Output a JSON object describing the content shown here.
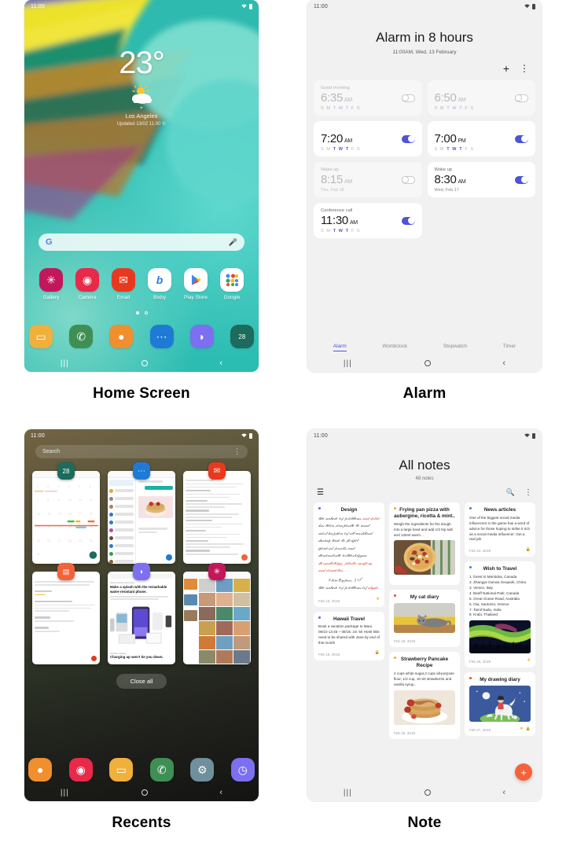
{
  "panels": [
    {
      "caption": "Home Screen"
    },
    {
      "caption": "Alarm"
    },
    {
      "caption": "Recents"
    },
    {
      "caption": "Note"
    }
  ],
  "status_bar": {
    "time": "11:00",
    "wifi_icon": "wifi-icon",
    "battery_icon": "battery-icon"
  },
  "nav_bar": {
    "recents_icon": "recents-icon",
    "home_icon": "home-icon",
    "back_icon": "back-icon"
  },
  "home": {
    "weather": {
      "temperature": "23°",
      "condition_icon": "partly-sunny-icon",
      "location_pin_icon": "location-pin-icon",
      "city": "Los Angeles",
      "updated": "Updated 13/02 11:00",
      "refresh_icon": "refresh-icon"
    },
    "search": {
      "logo": "G",
      "placeholder": "",
      "mic_icon": "microphone-icon"
    },
    "apps": [
      {
        "label": "Gallery",
        "icon": "gallery-icon",
        "glyph": "✳",
        "color": "#c2185b"
      },
      {
        "label": "Camera",
        "icon": "camera-icon",
        "glyph": "◉",
        "color": "#e8294a"
      },
      {
        "label": "Email",
        "icon": "email-icon",
        "glyph": "✉",
        "color": "#e8391f"
      },
      {
        "label": "Bixby",
        "icon": "bixby-icon",
        "glyph": "b",
        "color": "#ffffff"
      },
      {
        "label": "Play Store",
        "icon": "play-store-icon",
        "glyph": "▶",
        "color": "#ffffff"
      },
      {
        "label": "Google",
        "icon": "google-folder-icon",
        "glyph": "⠿",
        "color": "#ffffff"
      }
    ],
    "page_dots": {
      "count": 2,
      "active": 1
    },
    "dock": [
      {
        "icon": "my-files-icon",
        "glyph": "▭",
        "color": "#f0b03c"
      },
      {
        "icon": "phone-icon",
        "glyph": "✆",
        "color": "#3f8f55"
      },
      {
        "icon": "contacts-icon",
        "glyph": "●",
        "color": "#f08f2e"
      },
      {
        "icon": "messages-icon",
        "glyph": "⋯",
        "color": "#1f7ad6"
      },
      {
        "icon": "internet-icon",
        "glyph": "◗",
        "color": "#7c6ff0"
      },
      {
        "icon": "calendar-icon",
        "glyph": "28",
        "color": "#1d6b5c"
      }
    ]
  },
  "alarm": {
    "headline": "Alarm in 8 hours",
    "subhead": "11:00AM, Wed, 13 February",
    "add_icon": "plus-icon",
    "more_icon": "more-options-icon",
    "alarms": [
      {
        "name": "Good morning",
        "time": "6:35",
        "ampm": "AM",
        "days": "SMTWTFS",
        "active_days": [
          2,
          3,
          4
        ],
        "enabled": false,
        "date": ""
      },
      {
        "name": "",
        "time": "6:50",
        "ampm": "AM",
        "days": "SMTWTFS",
        "active_days": [
          2,
          3,
          4
        ],
        "enabled": false,
        "date": ""
      },
      {
        "name": "",
        "time": "7:20",
        "ampm": "AM",
        "days": "SMTWTFS",
        "active_days": [
          2,
          3,
          4
        ],
        "enabled": true,
        "date": ""
      },
      {
        "name": "",
        "time": "7:00",
        "ampm": "PM",
        "days": "SMTWTFS",
        "active_days": [
          2,
          3,
          4
        ],
        "enabled": true,
        "date": ""
      },
      {
        "name": "Wake up",
        "time": "8:15",
        "ampm": "AM",
        "days": "",
        "active_days": [],
        "enabled": false,
        "date": "Thu, Feb 18"
      },
      {
        "name": "Wake up",
        "time": "8:30",
        "ampm": "AM",
        "days": "",
        "active_days": [],
        "enabled": true,
        "date": "Wed, Feb 17"
      },
      {
        "name": "Conference call",
        "time": "11:30",
        "ampm": "AM",
        "days": "SMTWTFS",
        "active_days": [
          2,
          3,
          4
        ],
        "enabled": true,
        "date": ""
      }
    ],
    "tabs": [
      {
        "label": "Alarm",
        "active": true
      },
      {
        "label": "Worldclock",
        "active": false
      },
      {
        "label": "Stopwatch",
        "active": false
      },
      {
        "label": "Timer",
        "active": false
      }
    ],
    "accent": "#4d54d6"
  },
  "recents": {
    "search": {
      "placeholder": "Search",
      "more_icon": "more-options-icon"
    },
    "close_all_label": "Close all",
    "cards": [
      {
        "app": "Calendar",
        "badge_icon": "calendar-icon",
        "badge_glyph": "28",
        "badge_color": "#1d6b5c",
        "type": "calendar"
      },
      {
        "app": "Messages",
        "badge_icon": "messages-icon",
        "badge_glyph": "⋯",
        "badge_color": "#1f7ad6",
        "type": "messages"
      },
      {
        "app": "Email",
        "badge_icon": "email-icon",
        "badge_glyph": "✉",
        "badge_color": "#e8391f",
        "type": "email"
      },
      {
        "app": "Samsung Notes",
        "badge_icon": "notes-icon",
        "badge_glyph": "▤",
        "badge_color": "#f4623a",
        "type": "notes"
      },
      {
        "app": "Internet",
        "badge_icon": "internet-icon",
        "badge_glyph": "◗",
        "badge_color": "#7c6ff0",
        "type": "web",
        "headline": "Make a splash with the remarkable water-resistant phone.",
        "kicker": "Water-resistant technology",
        "footline": "Charging up won't tie you down.",
        "foot_kicker": "Wireless charging"
      },
      {
        "app": "Gallery",
        "badge_icon": "gallery-icon",
        "badge_glyph": "✳",
        "badge_color": "#c2185b",
        "type": "gallery"
      }
    ],
    "dock": [
      {
        "icon": "contacts-icon",
        "glyph": "●",
        "color": "#f08f2e"
      },
      {
        "icon": "camera-icon",
        "glyph": "◉",
        "color": "#e8294a"
      },
      {
        "icon": "my-files-icon",
        "glyph": "▭",
        "color": "#f0b03c"
      },
      {
        "icon": "phone-icon",
        "glyph": "✆",
        "color": "#3f8f55"
      },
      {
        "icon": "settings-icon",
        "glyph": "⚙",
        "color": "#6f8f9c"
      },
      {
        "icon": "clock-icon",
        "glyph": "◷",
        "color": "#7c6ff0"
      }
    ]
  },
  "note": {
    "title": "All notes",
    "count": "48 notes",
    "menu_icon": "hamburger-menu-icon",
    "search_icon": "search-icon",
    "more_icon": "more-options-icon",
    "add_icon": "plus-icon",
    "add_color": "#f4623a",
    "notes": [
      {
        "title": "Design",
        "dot_color": "#4d6ef0",
        "kind": "handwriting",
        "body": "",
        "date": "Feb 13, 2019",
        "starred": true,
        "locked": false,
        "image": ""
      },
      {
        "title": "Hawaii Travel",
        "dot_color": "#4d6ef0",
        "kind": "text",
        "body": "Book a vacation  package to Maui. 08/10 13:45 ~ 08/15 ,19. 50 Hotel lists need to be shared with Jane by end of this month",
        "date": "Feb 15, 2019",
        "starred": false,
        "locked": true,
        "image": ""
      },
      {
        "title": "Frying pan pizza with aubergine, ricotta & mint..",
        "dot_color": "#f5a623",
        "kind": "text-image",
        "body": "Weigh the ingredients for the dough into a large bowl and add 1/2 tsp salt and 125ml warm ..",
        "date": "",
        "starred": false,
        "locked": false,
        "image": "pizza"
      },
      {
        "title": "My cat diary",
        "dot_color": "#e8482a",
        "kind": "image",
        "body": "",
        "date": "Feb 19, 2019",
        "starred": false,
        "locked": false,
        "image": "cat"
      },
      {
        "title": "Strawberry Pancake Recipe",
        "dot_color": "#f5a623",
        "kind": "text-image",
        "body": "2 cups white sugar,2 cups all-purpose flour, 1/2 cup, 10-20 strawberris and vanilla syrup..",
        "date": "Feb 20, 2019",
        "starred": false,
        "locked": false,
        "image": "pancake"
      },
      {
        "title": "News articles",
        "dot_color": "#4d6ef0",
        "kind": "text",
        "body": "One of the biggest social media influencers in the game has a word of advice for those hoping to strike it rich as a social media influencer: Get a real job",
        "date": "Feb 24, 2019",
        "starred": false,
        "locked": true,
        "image": ""
      },
      {
        "title": "Wish to Travel",
        "dot_color": "#4d6ef0",
        "kind": "list-image",
        "list": [
          "forest in Manitoba, Canada",
          "Zhangye Danxia Geopark, China",
          "Venice, Italy",
          "Banff National Park, Canada",
          "Great Ocean Road, Australia",
          "Oia, Santorini, Greece",
          "Tamil Nadu, India",
          "Krabi, Thailand"
        ],
        "body": "",
        "date": "Feb 26, 2019",
        "starred": true,
        "locked": false,
        "image": "aurora"
      },
      {
        "title": "My drawing diary",
        "dot_color": "#e8482a",
        "kind": "image",
        "body": "",
        "date": "Feb 27, 2019",
        "starred": true,
        "locked": true,
        "image": "drawing"
      }
    ]
  }
}
